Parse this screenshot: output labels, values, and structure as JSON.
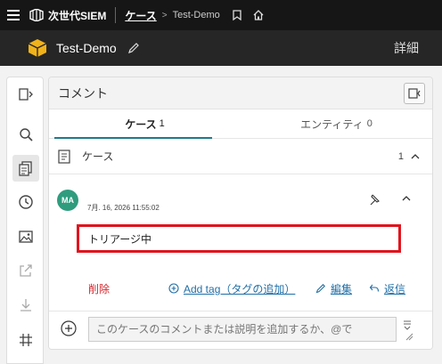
{
  "topbar": {
    "app_name": "次世代SIEM",
    "breadcrumb_root": "ケース",
    "breadcrumb_current": "Test-Demo"
  },
  "titlebar": {
    "title": "Test-Demo",
    "details_label": "詳細"
  },
  "rail": {
    "items": [
      "expand-panel-icon",
      "search-icon",
      "cases-icon",
      "history-icon",
      "image-icon",
      "export-icon",
      "download-icon",
      "grid-icon"
    ]
  },
  "panel": {
    "title": "コメント",
    "tabs": [
      {
        "label": "ケース",
        "count": "1"
      },
      {
        "label": "エンティティ",
        "count": "0"
      }
    ],
    "section": {
      "label": "ケース",
      "count": "1"
    },
    "comment": {
      "avatar_initials": "MA",
      "timestamp": "7月. 16, 2026 11:55:02",
      "text": "トリアージ中",
      "delete_label": "削除",
      "add_tag_label": "Add tag（タグの追加）",
      "edit_label": "編集",
      "reply_label": "返信"
    },
    "composer": {
      "placeholder": "このケースのコメントまたは説明を追加するか、@で"
    }
  },
  "colors": {
    "accent": "#1f7a8c",
    "link": "#1f6fa8",
    "danger": "#d6242b",
    "highlight_border": "#e0141e",
    "avatar_bg": "#2f9c7e",
    "cube_icon": "#f0b21a"
  }
}
